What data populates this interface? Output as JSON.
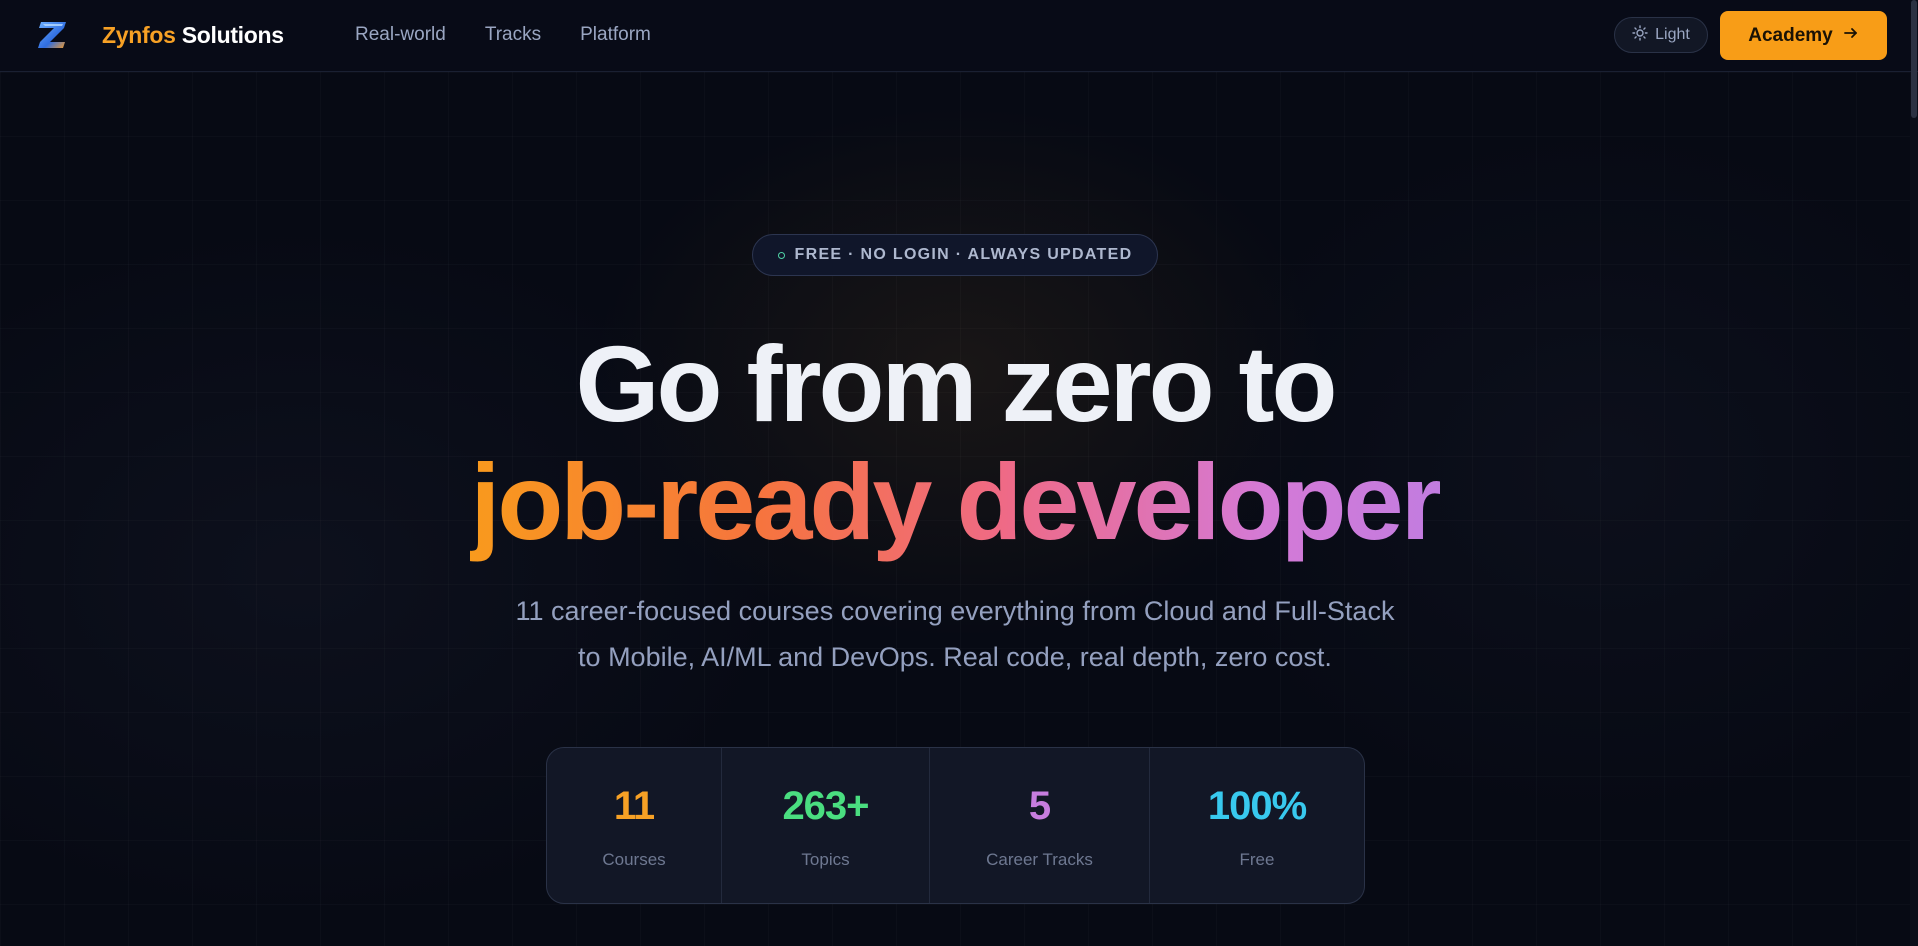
{
  "header": {
    "brand_part1": "Zynfos",
    "brand_part2": "Solutions",
    "nav": [
      "Real-world",
      "Tracks",
      "Platform"
    ],
    "theme_toggle_label": "Light",
    "cta_label": "Academy",
    "icons": {
      "logo": "z-logo-icon",
      "theme": "sun-icon",
      "cta": "arrow-right-icon"
    }
  },
  "hero": {
    "badge": "FREE · NO LOGIN · ALWAYS UPDATED",
    "title_line1": "Go from zero to",
    "title_line2": "job-ready developer",
    "subtitle": "11 career-focused courses covering everything from Cloud and Full-Stack to Mobile, AI/ML and DevOps. Real code, real depth, zero cost."
  },
  "stats": [
    {
      "value": "11",
      "label": "Courses",
      "color": "#f7a125"
    },
    {
      "value": "263+",
      "label": "Topics",
      "color": "#4ade80"
    },
    {
      "value": "5",
      "label": "Career Tracks",
      "color": "#c77ddf"
    },
    {
      "value": "100%",
      "label": "Free",
      "color": "#38c9ee"
    }
  ],
  "colors": {
    "background": "#070a14",
    "accent": "#f89d17",
    "title_gradient": [
      "#f99a1d",
      "#ef6a86",
      "#c27ce0"
    ]
  }
}
